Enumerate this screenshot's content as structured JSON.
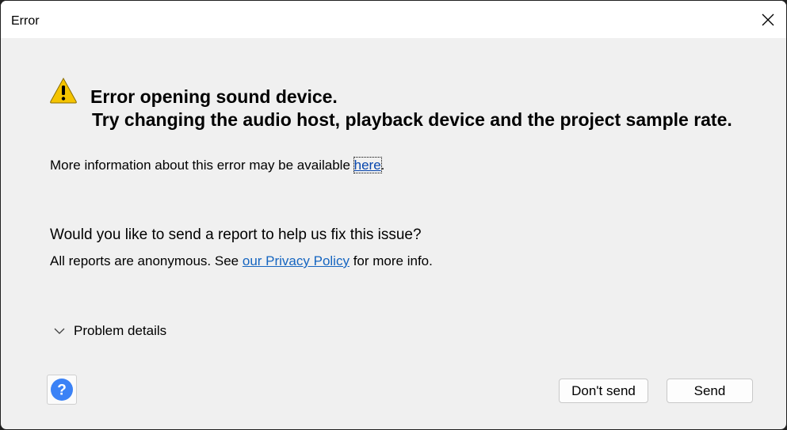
{
  "window": {
    "title": "Error"
  },
  "icons": {
    "close": "close-icon",
    "warning": "warning-icon",
    "chevron": "chevron-down-icon",
    "help": "help-icon"
  },
  "colors": {
    "warning_fill": "#f5c400",
    "link": "#0645ad",
    "privacy_link": "#1565c0",
    "help_blue": "#3b82f6"
  },
  "message": {
    "heading_line1": "Error opening sound device.",
    "heading_line2": "Try changing the audio host, playback device and the project sample rate.",
    "info_prefix": "More information about this error may be available ",
    "info_link": "here",
    "info_suffix": "."
  },
  "report": {
    "question": "Would you like to send a report to help us fix this issue?",
    "anon_prefix": "All reports are anonymous. See ",
    "privacy_link": "our Privacy Policy",
    "anon_suffix": " for more info."
  },
  "details": {
    "label": "Problem details"
  },
  "buttons": {
    "dont_send": "Don't send",
    "send": "Send",
    "help": "?"
  }
}
